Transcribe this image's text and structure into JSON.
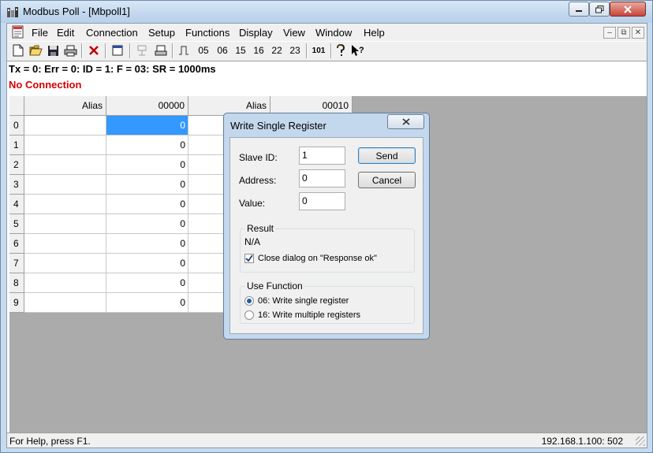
{
  "window": {
    "title": "Modbus Poll - [Mbpoll1]"
  },
  "menu": [
    "File",
    "Edit",
    "Connection",
    "Setup",
    "Functions",
    "Display",
    "View",
    "Window",
    "Help"
  ],
  "toolbar": {
    "function_codes": [
      "05",
      "06",
      "15",
      "16",
      "22",
      "23"
    ],
    "packet_label": "101"
  },
  "status_line": "Tx = 0: Err = 0: ID = 1: F = 03: SR = 1000ms",
  "connection_status": "No Connection",
  "grid": {
    "headers": [
      "Alias",
      "00000",
      "Alias",
      "00010"
    ],
    "row_numbers": [
      "0",
      "1",
      "2",
      "3",
      "4",
      "5",
      "6",
      "7",
      "8",
      "9"
    ],
    "values": [
      "0",
      "0",
      "0",
      "0",
      "0",
      "0",
      "0",
      "0",
      "0",
      "0"
    ],
    "selected_row": 0
  },
  "statusbar": {
    "help": "For Help, press F1.",
    "address": "192.168.1.100: 502"
  },
  "dialog": {
    "title": "Write Single Register",
    "slave_id_label": "Slave ID:",
    "slave_id_value": "1",
    "address_label": "Address:",
    "address_value": "0",
    "value_label": "Value:",
    "value_value": "0",
    "send_label": "Send",
    "cancel_label": "Cancel",
    "result_group": "Result",
    "result_value": "N/A",
    "close_on_ok_label": "Close dialog on \"Response ok\"",
    "close_on_ok_checked": true,
    "use_function_group": "Use Function",
    "option_06": "06: Write single register",
    "option_16": "16: Write multiple registers",
    "selected_option": "06"
  }
}
